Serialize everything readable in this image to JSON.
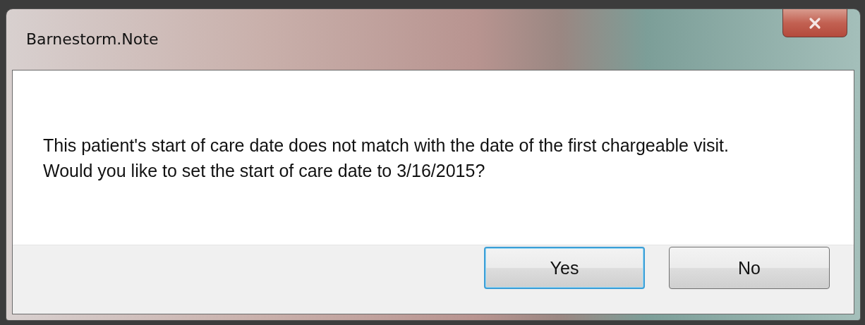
{
  "window": {
    "title": "Barnestorm.Note"
  },
  "message": "This patient's start of care date does not match with the date of the first chargeable visit.  Would you like to set the start of care date to 3/16/2015?",
  "buttons": [
    {
      "label": "Yes",
      "default": true
    },
    {
      "label": "No",
      "default": false
    }
  ]
}
